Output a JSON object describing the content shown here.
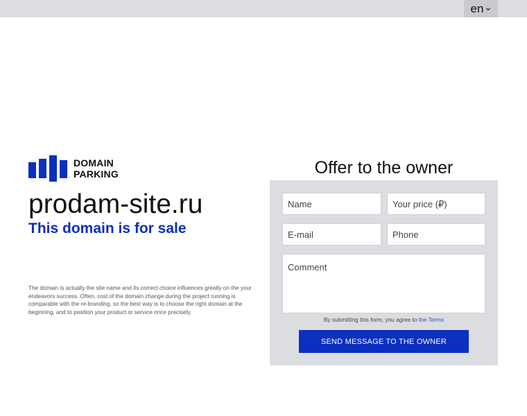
{
  "header": {
    "language": "en",
    "language_icon": "chevron-down-icon"
  },
  "brand": {
    "logo_line1": "DOMAIN",
    "logo_line2": "PARKING",
    "logo_color": "#0b2fbf"
  },
  "hero": {
    "domain": "prodam-site.ru",
    "tagline": "This domain is for sale",
    "description": "The domain is actually the site name and its correct choice influences greatly on the your endeavors success. Often, cost of the domain change during the project running is comparable with the re-branding, so the best way is to choose the right domain at the beginning, and to position your product or service once precisely."
  },
  "offer_form": {
    "title": "Offer to the owner",
    "name_placeholder": "Name",
    "price_placeholder": "Your price (₽)",
    "email_placeholder": "E-mail",
    "phone_placeholder": "Phone",
    "comment_placeholder": "Comment",
    "terms_prefix": "By submitting this form, you agree to",
    "terms_link": "the Terms",
    "submit_label": "SEND MESSAGE TO THE OWNER"
  },
  "colors": {
    "accent": "#0b2fbf",
    "panel": "#dcdde1",
    "link": "#2a55d0"
  }
}
